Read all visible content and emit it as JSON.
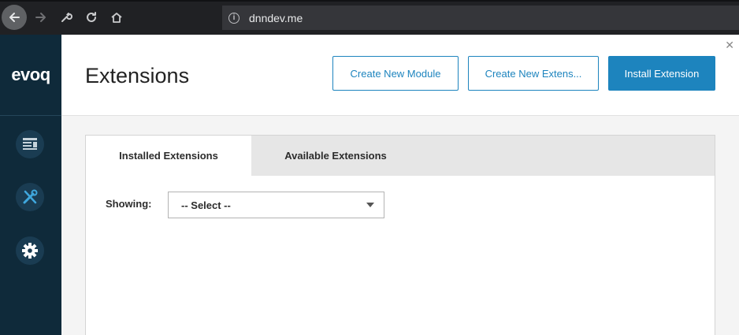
{
  "browser": {
    "url": "dnndev.me"
  },
  "sidebar": {
    "logo": "evoq",
    "items": [
      {
        "icon": "content-icon"
      },
      {
        "icon": "tools-icon"
      },
      {
        "icon": "settings-gear-icon"
      }
    ]
  },
  "header": {
    "title": "Extensions",
    "buttons": {
      "create_module": "Create New Module",
      "create_extension": "Create New Extens...",
      "install_extension": "Install Extension"
    }
  },
  "tabs": [
    {
      "label": "Installed Extensions",
      "active": true
    },
    {
      "label": "Available Extensions",
      "active": false
    }
  ],
  "filter": {
    "label": "Showing:",
    "selected": "-- Select --"
  },
  "colors": {
    "accent": "#1d84be",
    "sidebar": "#0f2a3a"
  }
}
